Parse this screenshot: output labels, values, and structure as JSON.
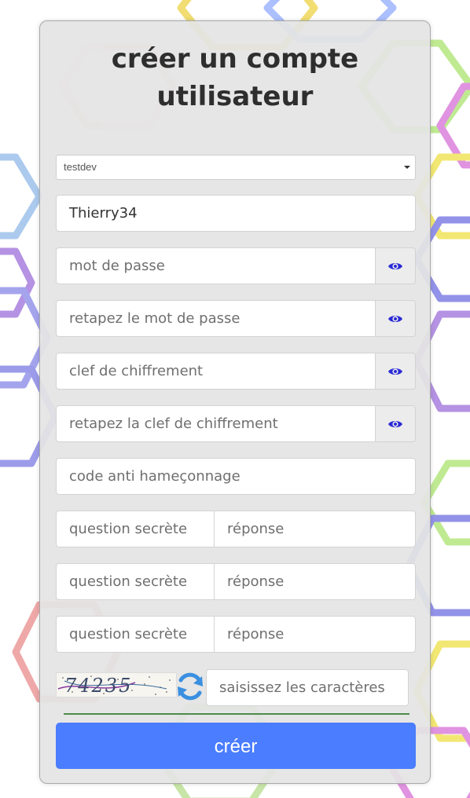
{
  "form": {
    "title": "créer un compte utilisateur",
    "domain_select": {
      "value": "testdev"
    },
    "username": {
      "value": "Thierry34"
    },
    "password": {
      "placeholder": "mot de passe"
    },
    "password_confirm": {
      "placeholder": "retapez le mot de passe"
    },
    "encryption_key": {
      "placeholder": "clef de chiffrement"
    },
    "encryption_key_confirm": {
      "placeholder": "retapez la clef de chiffrement"
    },
    "anti_phishing": {
      "placeholder": "code anti hameçonnage"
    },
    "security_questions": [
      {
        "question_placeholder": "question secrète",
        "answer_placeholder": "réponse"
      },
      {
        "question_placeholder": "question secrète",
        "answer_placeholder": "réponse"
      },
      {
        "question_placeholder": "question secrète",
        "answer_placeholder": "réponse"
      }
    ],
    "captcha": {
      "image_text": "74235",
      "input_placeholder": "saisissez les caractères"
    },
    "submit_label": "créer"
  },
  "icons": {
    "toggle_visibility": "eye-icon",
    "refresh_captcha": "refresh-icon"
  },
  "colors": {
    "primary": "#4a7dff",
    "icon": "#2b2bd6",
    "refresh": "#3a8fe0",
    "underline": "#4b8b4b"
  }
}
